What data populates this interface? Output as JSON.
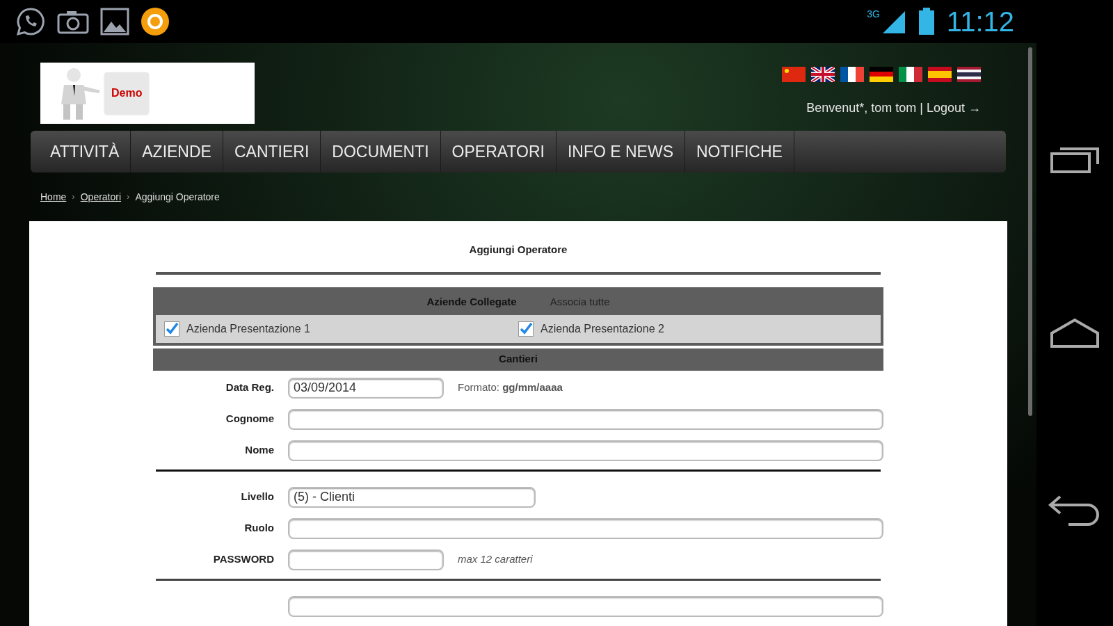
{
  "status_bar": {
    "network": "3G",
    "time": "11:12"
  },
  "header": {
    "logo_text": "Demo",
    "greeting": "Benvenut*, tom tom",
    "separator": "|",
    "logout": "Logout",
    "logout_arrow": "→"
  },
  "menu": [
    {
      "label": "ATTIVITÀ"
    },
    {
      "label": "AZIENDE"
    },
    {
      "label": "CANTIERI"
    },
    {
      "label": "DOCUMENTI"
    },
    {
      "label": "OPERATORI"
    },
    {
      "label": "INFO E NEWS"
    },
    {
      "label": "NOTIFICHE"
    }
  ],
  "breadcrumb": [
    {
      "label": "Home",
      "link": true
    },
    {
      "separator": "›",
      "label": "Operatori",
      "link": true
    },
    {
      "separator": "›",
      "label": "Aggiungi Operatore",
      "link": false
    }
  ],
  "form": {
    "title": "Aggiungi Operatore",
    "companies": {
      "title": "Aziende Collegate",
      "action": "Associa tutte",
      "items": [
        {
          "label": "Azienda Presentazione 1",
          "checked": true
        },
        {
          "label": "Azienda Presentazione 2",
          "checked": true
        }
      ]
    },
    "sites_title": "Cantieri",
    "groups": [
      [
        {
          "label": "Data Reg.",
          "value": "03/09/2014",
          "kind": "short",
          "hint": "Formato: **gg/mm/aaaa**"
        },
        {
          "label": "Cognome",
          "kind": "full"
        },
        {
          "label": "Nome",
          "kind": "full"
        }
      ],
      [
        {
          "label": "Livello",
          "value": "(5) - Clienti",
          "kind": "medium"
        },
        {
          "label": "Ruolo",
          "kind": "full"
        },
        {
          "label": "PASSWORD",
          "kind": "short",
          "hint": "*max 12 caratteri*"
        }
      ],
      [
        {
          "kind": "full"
        }
      ]
    ]
  }
}
